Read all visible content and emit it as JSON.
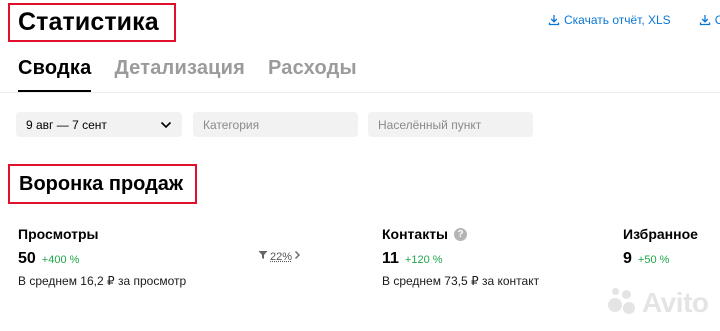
{
  "page_title": "Статистика",
  "top_links": [
    {
      "label": "Скачать отчёт, XLS"
    },
    {
      "label": "Ск"
    }
  ],
  "tabs": [
    {
      "label": "Сводка",
      "active": true
    },
    {
      "label": "Детализация",
      "active": false
    },
    {
      "label": "Расходы",
      "active": false
    }
  ],
  "filters": {
    "date_range": "9 авг — 7 сент",
    "category_placeholder": "Категория",
    "city_placeholder": "Населённый пункт"
  },
  "section_title": "Воронка продаж",
  "metrics": {
    "views": {
      "title": "Просмотры",
      "value": "50",
      "delta": "+400 %",
      "note": "В среднем 16,2 ₽ за просмотр"
    },
    "conversion": {
      "label": "22%"
    },
    "contacts": {
      "title": "Контакты",
      "value": "11",
      "delta": "+120 %",
      "note": "В среднем 73,5 ₽ за контакт"
    },
    "favorites": {
      "title": "Избранное",
      "value": "9",
      "delta": "+50 %"
    }
  },
  "watermark": "Avito",
  "colors": {
    "accent": "#0a77d6",
    "positive": "#1fa64a",
    "highlight_border": "#e0102a",
    "filter_bg": "#f2f2f2"
  },
  "icons": [
    "download-icon",
    "chevron-down-icon",
    "filter-funnel-icon",
    "chevron-right-icon",
    "help-icon"
  ]
}
